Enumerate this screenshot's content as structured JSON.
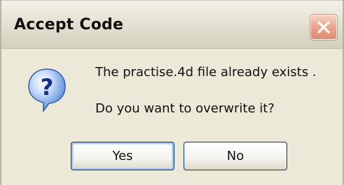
{
  "window": {
    "title": "Accept Code"
  },
  "icons": {
    "close": "close-icon",
    "question": "question-icon"
  },
  "message": {
    "line1": "The practise.4d file already exists .",
    "line2": "Do you want to overwrite it?"
  },
  "buttons": {
    "yes_label": "Yes",
    "no_label": "No"
  },
  "colors": {
    "close_button": "#e08a6d",
    "dialog_background": "#ece9d8",
    "question_icon": "#3a7ad6",
    "button_border": "#003c74"
  }
}
